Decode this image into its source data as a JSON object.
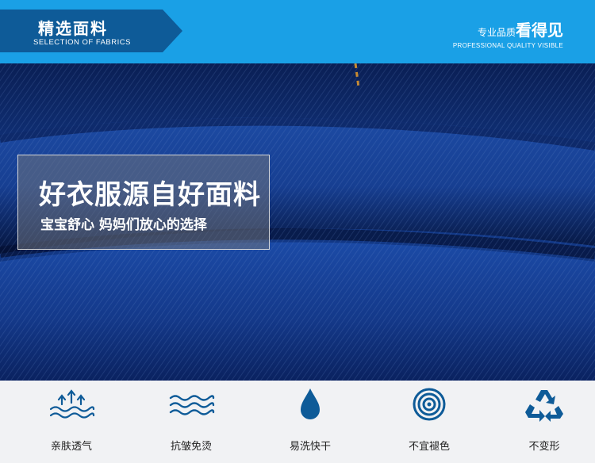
{
  "header": {
    "tag_title": "精选面料",
    "tag_subtitle": "SELECTION OF FABRICS",
    "right_small": "专业品质",
    "right_big": "看得见",
    "right_subtitle": "PROFESSIONAL QUALITY VISIBLE"
  },
  "overlay": {
    "title": "好衣服源自好面料",
    "subtitle": "宝宝舒心 妈妈们放心的选择"
  },
  "features": [
    {
      "label": "亲肤透气",
      "icon": "breathable-waves-icon"
    },
    {
      "label": "抗皱免烫",
      "icon": "wrinkle-free-waves-icon"
    },
    {
      "label": "易洗快干",
      "icon": "water-drop-icon"
    },
    {
      "label": "不宜褪色",
      "icon": "concentric-target-icon"
    },
    {
      "label": "不变形",
      "icon": "recycle-icon"
    }
  ],
  "colors": {
    "header_bg": "#1aa0e6",
    "tag_bg": "#0e5b98",
    "fabric_dark": "#0b2a6a",
    "icon_color": "#0e5b98",
    "features_bg": "#f1f2f4"
  }
}
